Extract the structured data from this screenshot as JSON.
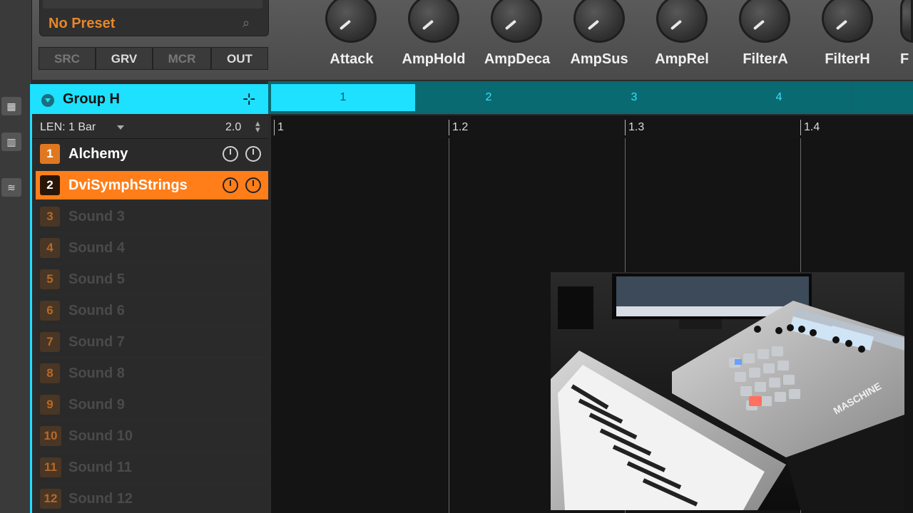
{
  "header": {
    "preset": "No Preset",
    "tabs": [
      {
        "label": "SRC",
        "active": false
      },
      {
        "label": "GRV",
        "active": true
      },
      {
        "label": "MCR",
        "active": false
      },
      {
        "label": "OUT",
        "active": true
      }
    ],
    "knobs": [
      "Attack",
      "AmpHold",
      "AmpDeca",
      "AmpSus",
      "AmpRel",
      "FilterA",
      "FilterH",
      "F"
    ]
  },
  "group": {
    "name": "Group H"
  },
  "patterns": [
    "1",
    "2",
    "3",
    "4"
  ],
  "length": {
    "label": "LEN: 1 Bar",
    "value": "2.0"
  },
  "ruler": [
    "1",
    "1.2",
    "1.3",
    "1.4"
  ],
  "sounds": [
    {
      "num": "1",
      "name": "Alchemy",
      "state": "normal"
    },
    {
      "num": "2",
      "name": "DviSymphStrings",
      "state": "active"
    },
    {
      "num": "3",
      "name": "Sound 3",
      "state": "empty"
    },
    {
      "num": "4",
      "name": "Sound 4",
      "state": "empty"
    },
    {
      "num": "5",
      "name": "Sound 5",
      "state": "empty"
    },
    {
      "num": "6",
      "name": "Sound 6",
      "state": "empty"
    },
    {
      "num": "7",
      "name": "Sound 7",
      "state": "empty"
    },
    {
      "num": "8",
      "name": "Sound 8",
      "state": "empty"
    },
    {
      "num": "9",
      "name": "Sound 9",
      "state": "empty"
    },
    {
      "num": "10",
      "name": "Sound 10",
      "state": "empty"
    },
    {
      "num": "11",
      "name": "Sound 11",
      "state": "empty"
    },
    {
      "num": "12",
      "name": "Sound 12",
      "state": "empty"
    }
  ],
  "colors": {
    "accent_cyan": "#1ee0ff",
    "accent_orange": "#ff7e1a"
  },
  "video_overlay": {
    "device_label": "MASCHINE"
  }
}
